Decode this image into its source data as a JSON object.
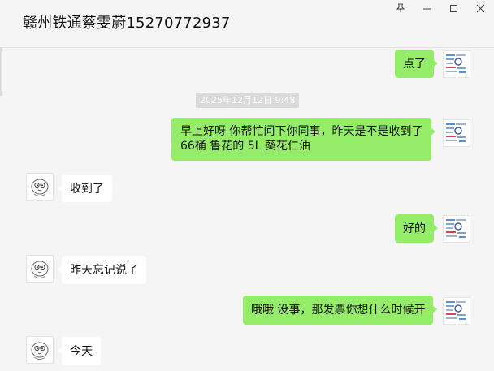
{
  "window": {
    "title": "赣州铁通蔡雯蔚15270772937",
    "controls": {
      "pin": "⊥",
      "minimize": "—",
      "maximize": "☐",
      "close": "✕"
    }
  },
  "timestamp": "2025年12月12日 9:48",
  "messages": [
    {
      "from": "me",
      "text": "点了"
    },
    {
      "from": "me",
      "lines": [
        "早上好呀  你帮忙问下你同事，昨天是不是收到了",
        "66桶 鲁花的 5L 葵花仁油"
      ]
    },
    {
      "from": "them",
      "text": "收到了"
    },
    {
      "from": "me",
      "text": "好的"
    },
    {
      "from": "them",
      "text": "昨天忘记说了"
    },
    {
      "from": "me",
      "text": "哦哦 没事，那发票你想什么时候开"
    },
    {
      "from": "them",
      "text": "今天"
    }
  ],
  "colors": {
    "me_bubble": "#95ec69",
    "them_bubble": "#ffffff",
    "background": "#f5f5f5"
  },
  "icons": {
    "my_avatar": "document-thumbnail-avatar",
    "their_avatar": "cartoon-face-avatar"
  }
}
